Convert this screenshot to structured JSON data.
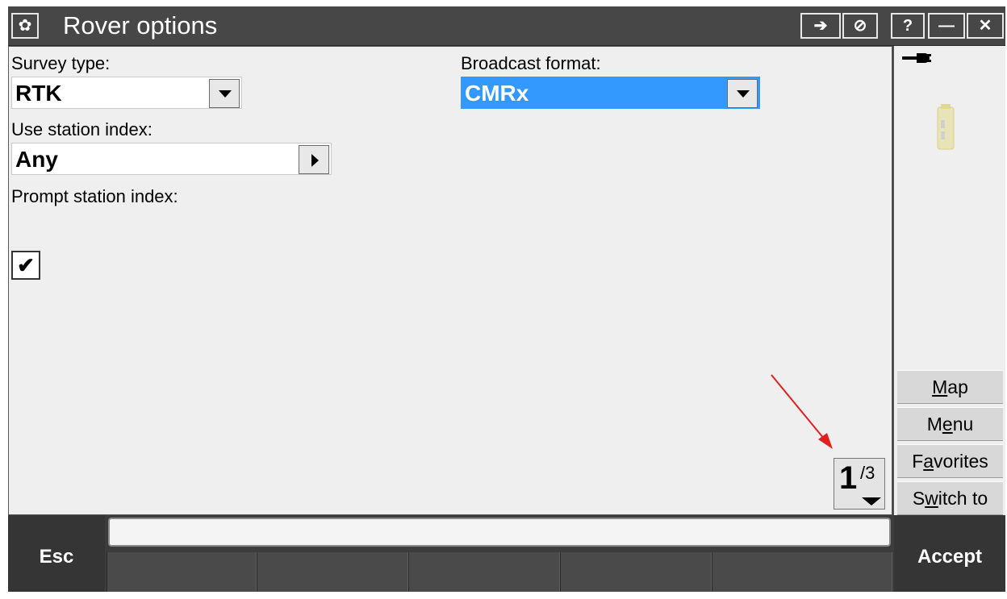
{
  "window": {
    "title": "Rover options"
  },
  "titlebar_buttons": {
    "help": "?",
    "minimize": "—",
    "close": "✕",
    "login_icon": "➔",
    "disable_icon": "⊘"
  },
  "form": {
    "survey_type": {
      "label": "Survey type:",
      "value": "RTK"
    },
    "broadcast_format": {
      "label": "Broadcast format:",
      "value": "CMRx"
    },
    "station_index": {
      "label": "Use station index:",
      "value": "Any"
    },
    "prompt_station_index": {
      "label": "Prompt station index:",
      "checked": true,
      "mark": "✔"
    }
  },
  "pager": {
    "current": "1",
    "total": "/3"
  },
  "sidebar": {
    "buttons": [
      "Map",
      "Menu",
      "Favorites",
      "Switch to"
    ],
    "underline_chars": [
      "M",
      "e",
      "a",
      "w"
    ]
  },
  "bottom": {
    "esc": "Esc",
    "accept": "Accept",
    "status_text": ""
  },
  "colors": {
    "selection": "#3399ff",
    "annotation_arrow": "#e02020"
  }
}
